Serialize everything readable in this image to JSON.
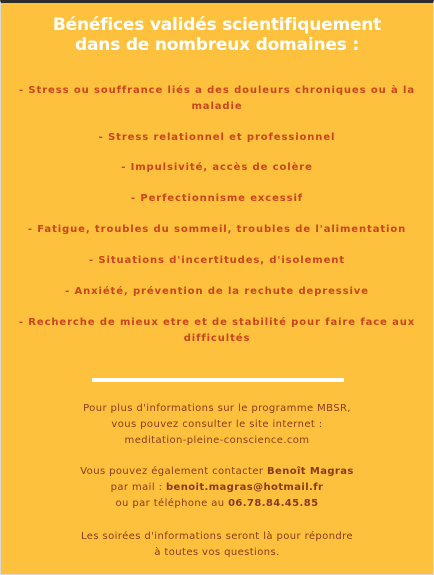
{
  "title": {
    "line1": "Bénéfices validés scientifiquement",
    "line2": "dans de nombreux domaines :"
  },
  "benefits": [
    "- Stress ou souffrance liés a des douleurs chroniques ou à la maladie",
    "- Stress relationnel et professionnel",
    "- Impulsivité, accès de colère",
    "- Perfectionnisme excessif",
    "- Fatigue, troubles du sommeil, troubles de l'alimentation",
    "- Situations d'incertitudes, d'isolement",
    "- Anxiété, prévention de la rechute depressive",
    "- Recherche de mieux etre et de stabilité pour faire face aux difficultés"
  ],
  "mbsr_info": {
    "line1": "Pour plus d'informations sur le programme MBSR,",
    "line2": "vous pouvez consulter le site internet :",
    "website": "meditation-pleine-conscience.com"
  },
  "contact": {
    "line1_prefix": "Vous pouvez également contacter ",
    "name": "Benoît Magras",
    "email_prefix": "par mail : ",
    "email": "benoit.magras@hotmail.fr",
    "phone_prefix": "ou par téléphone au ",
    "phone": "06.78.84.45.85"
  },
  "soirees": {
    "line1": "Les soirées d'informations seront là pour répondre",
    "line2": "à toutes vos questions."
  },
  "colors": {
    "background": "#fdc13d",
    "title": "#ffffff",
    "benefits": "#c8451f",
    "info_text": "#8a3a1e"
  }
}
